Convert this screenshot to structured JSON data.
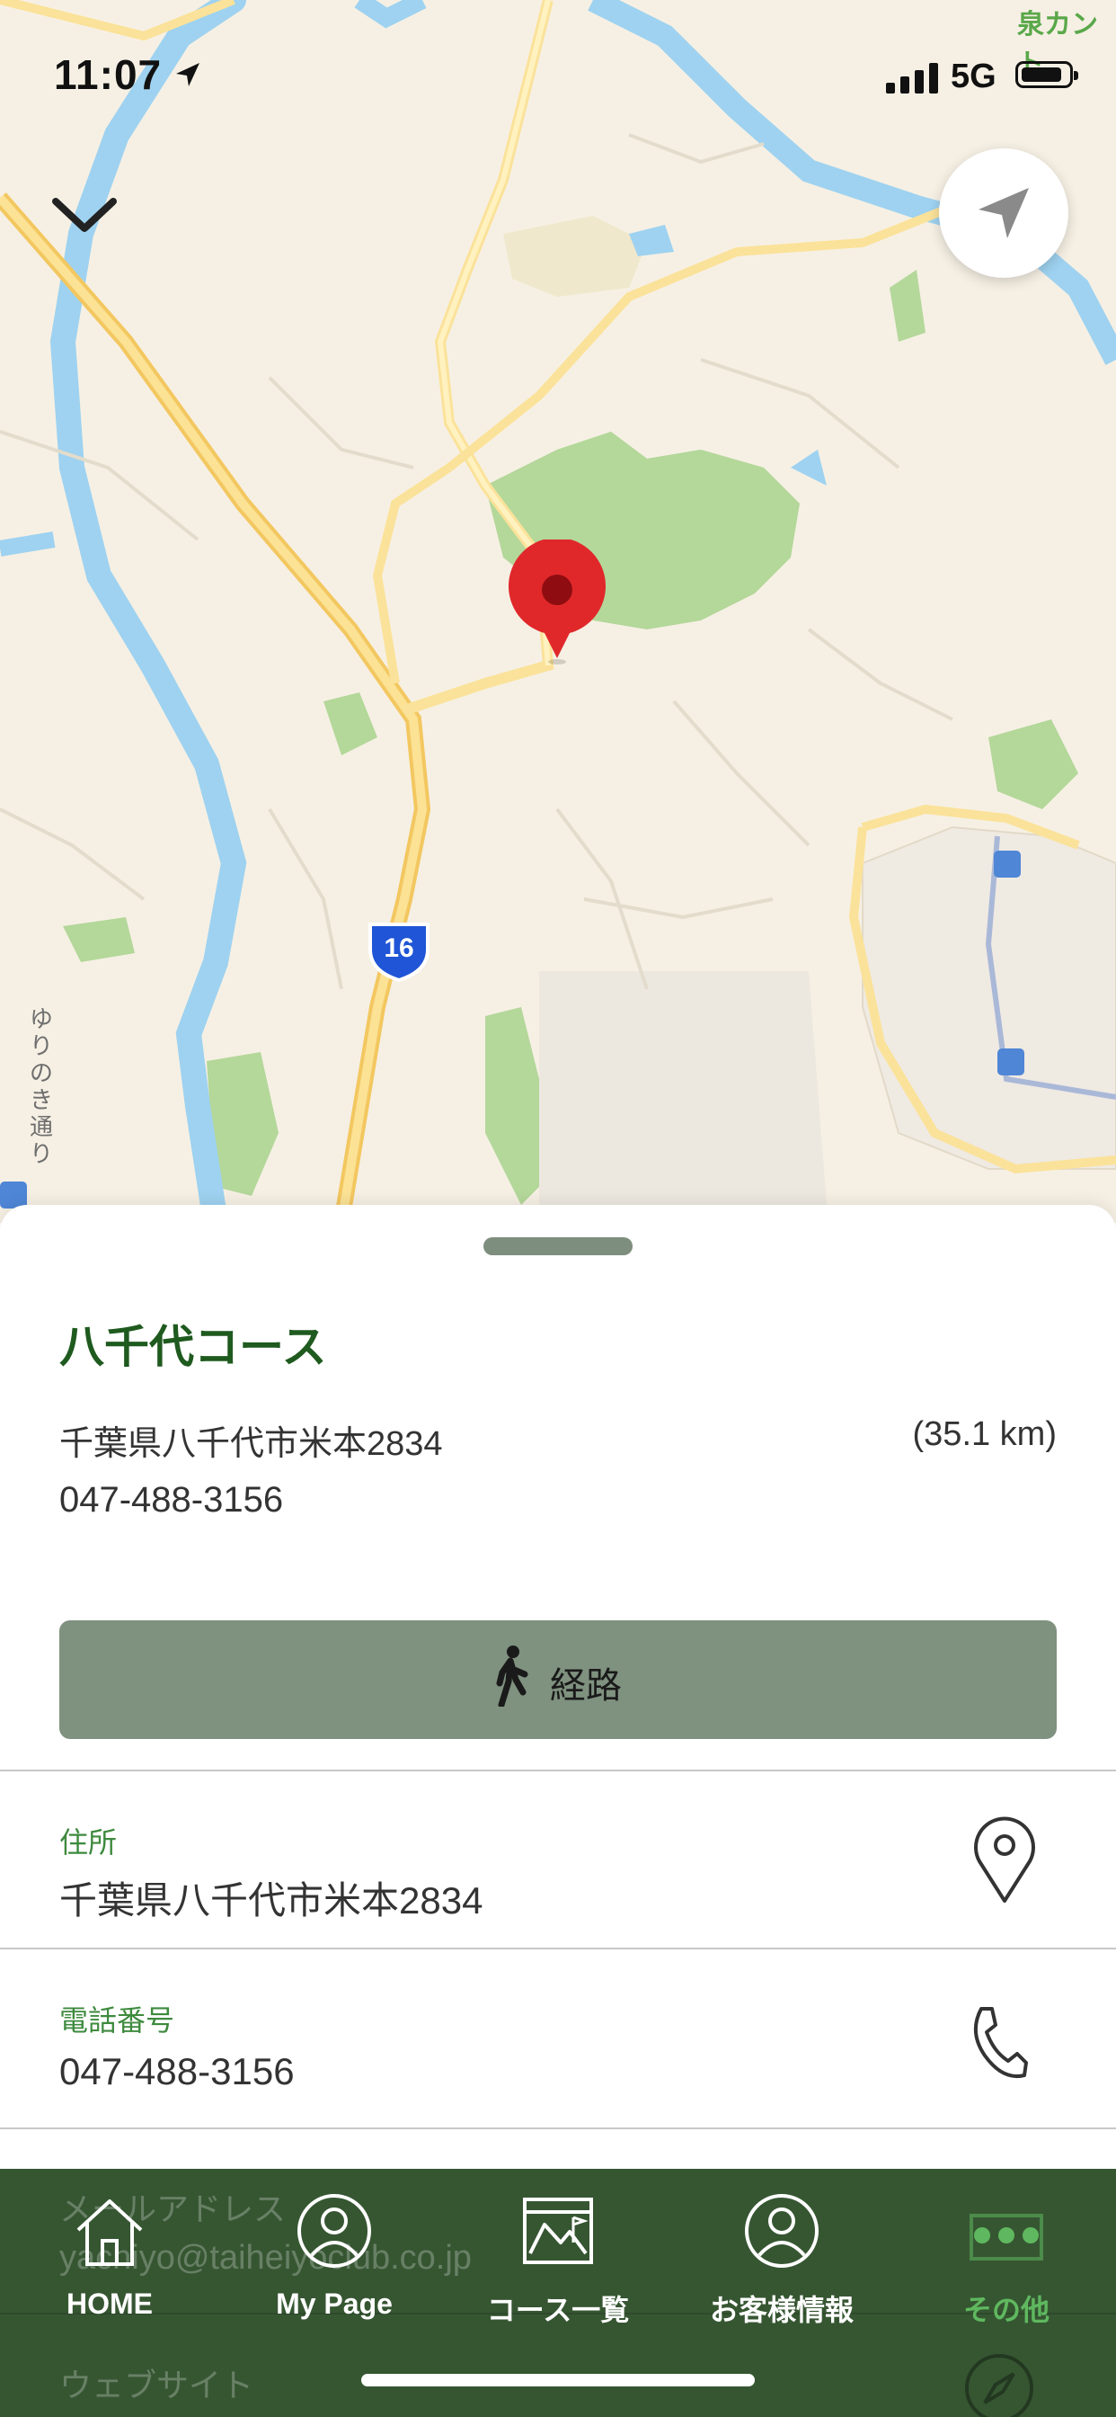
{
  "status_bar": {
    "time": "11:07",
    "network": "5G"
  },
  "map": {
    "top_label": "泉カント",
    "street_label": "ゆりのき通り",
    "highway_number": "16"
  },
  "place": {
    "name": "八千代コース",
    "address": "千葉県八千代市米本2834",
    "distance": "(35.1 km)",
    "phone": "047-488-3156"
  },
  "route_button": {
    "label": "経路"
  },
  "info_rows": {
    "address": {
      "label": "住所",
      "value": "千葉県八千代市米本2834"
    },
    "phone": {
      "label": "電話番号",
      "value": "047-488-3156"
    },
    "email": {
      "label": "メールアドレス",
      "value": "yachiyo@taiheiyoclub.co.jp"
    },
    "website": {
      "label": "ウェブサイト"
    }
  },
  "tabbar": {
    "tabs": [
      {
        "label": "HOME",
        "icon": "house-icon"
      },
      {
        "label": "My Page",
        "icon": "person-icon"
      },
      {
        "label": "コース一覧",
        "icon": "course-map-icon"
      },
      {
        "label": "お客様情報",
        "icon": "person-icon"
      },
      {
        "label": "その他",
        "icon": "more-icon"
      }
    ],
    "active_index": 4
  },
  "colors": {
    "brand_green": "#1f5a1f",
    "route_button": "#7f917f",
    "tabbar": "#20441c",
    "pin": "#e0282b"
  }
}
